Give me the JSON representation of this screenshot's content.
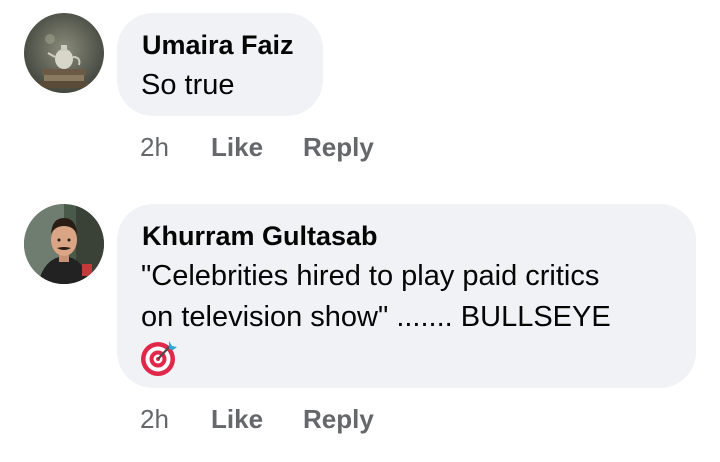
{
  "comments": [
    {
      "author": "Umaira Faiz",
      "lines": [
        "So true"
      ],
      "time": "2h",
      "like_label": "Like",
      "reply_label": "Reply",
      "avatar_icon": "profile-photo-teapot-books"
    },
    {
      "author": "Khurram Gultasab",
      "lines": [
        "\"Celebrities hired to play paid critics",
        "on television show\" ....... BULLSEYE"
      ],
      "emoji": "direct-hit-target-emoji",
      "time": "2h",
      "like_label": "Like",
      "reply_label": "Reply",
      "avatar_icon": "profile-photo-man-mustache"
    }
  ],
  "colors": {
    "bubble_bg": "#f0f2f5",
    "text": "#050505",
    "secondary_text": "#65676b",
    "target_red": "#e0284a"
  }
}
